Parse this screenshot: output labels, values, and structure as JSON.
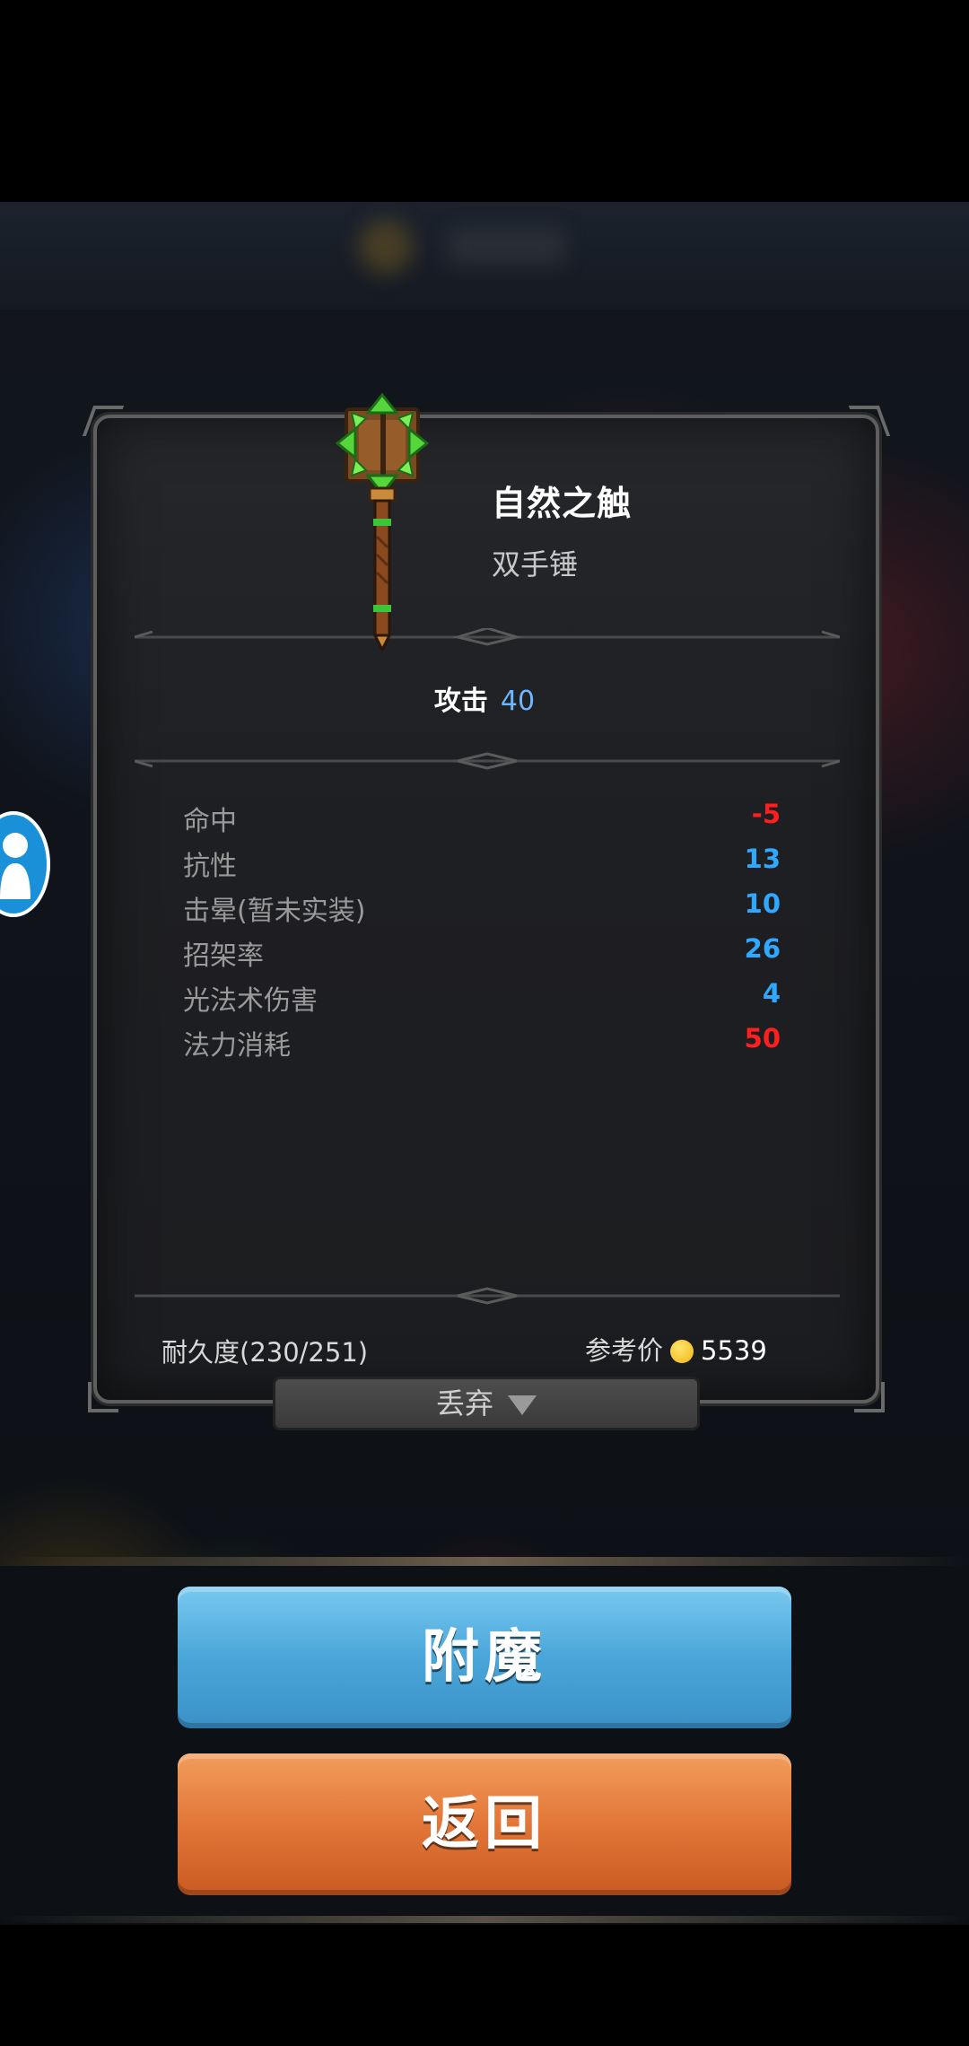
{
  "item": {
    "name": "自然之触",
    "type": "双手锤",
    "attack_label": "攻击",
    "attack_value": "40",
    "icon": "two-handed-mace-icon"
  },
  "stats": [
    {
      "name": "命中",
      "value": "-5",
      "color": "#ff1f1f"
    },
    {
      "name": "抗性",
      "value": "13",
      "color": "#2fa8ff"
    },
    {
      "name": "击晕(暂未实装)",
      "value": "10",
      "color": "#2fa8ff"
    },
    {
      "name": "招架率",
      "value": "26",
      "color": "#2fa8ff"
    },
    {
      "name": "光法术伤害",
      "value": "4",
      "color": "#2fa8ff"
    },
    {
      "name": "法力消耗",
      "value": "50",
      "color": "#ff1f1f"
    }
  ],
  "footer": {
    "durability": "耐久度(230/251)",
    "price_label": "参考价",
    "price_value": "5539",
    "coin_icon": "gold-coin-icon"
  },
  "buttons": {
    "discard": "丢弃",
    "enchant": "附魔",
    "back": "返回"
  },
  "colors": {
    "enchant_button": "#4aa6d9",
    "back_button": "#e27638",
    "attack_value": "#6eb6ff"
  }
}
